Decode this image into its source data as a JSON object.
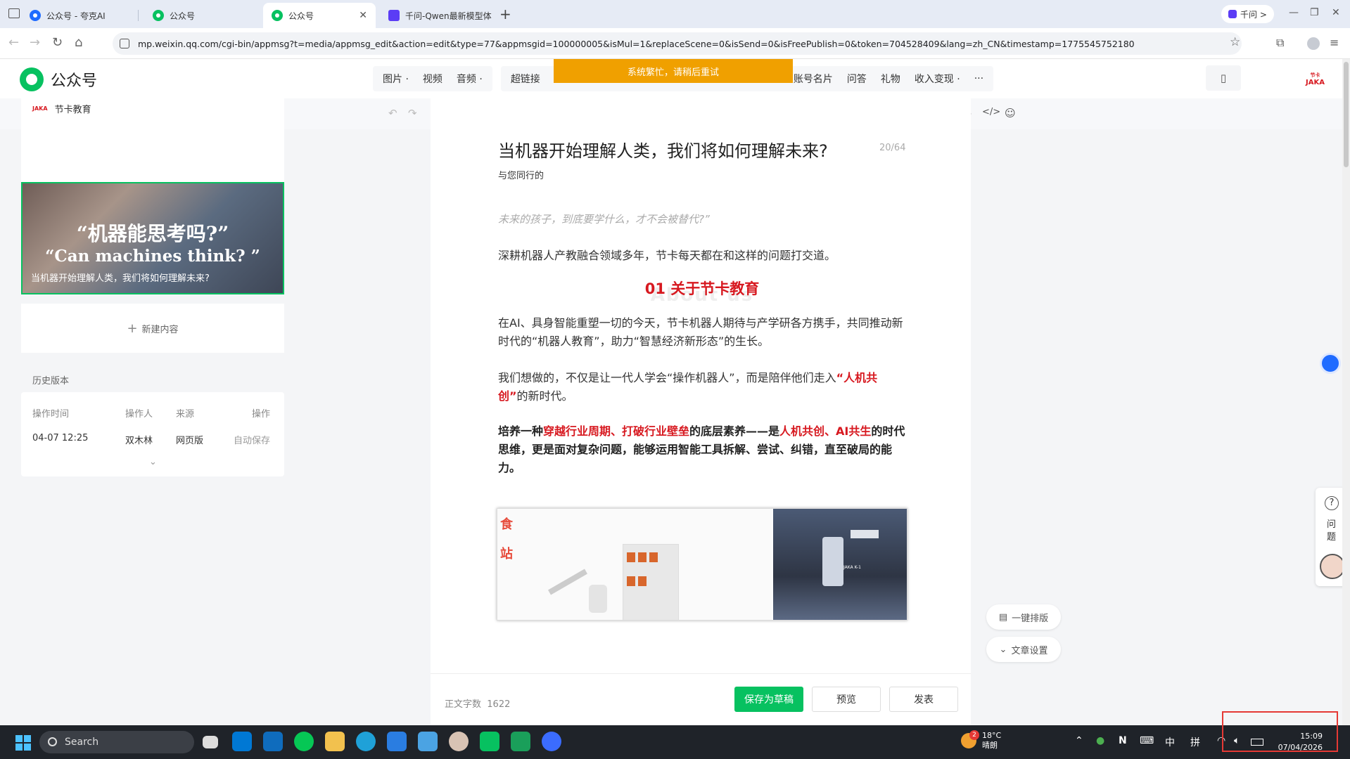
{
  "browser": {
    "tabs": [
      {
        "label": "公众号 - 夸克AI",
        "icon": "quark-icon"
      },
      {
        "label": "公众号",
        "icon": "wechat-mp-icon"
      },
      {
        "label": "公众号",
        "icon": "wechat-mp-icon"
      },
      {
        "label": "千问-Qwen最新模型体",
        "icon": "qwen-icon"
      }
    ],
    "qwen_pill": "千问 >",
    "url": "mp.weixin.qq.com/cgi-bin/appmsg?t=media/appmsg_edit&action=edit&type=77&appmsgid=100000005&isMul=1&replaceScene=0&isSend=0&isFreePublish=0&token=704528409&lang=zh_CN&timestamp=1775545752180"
  },
  "header": {
    "logo_text": "公众号",
    "menu_group1": [
      "图片 ·",
      "视频",
      "音频 ·"
    ],
    "menu_group2": [
      "超链接",
      "账号名片",
      "问答",
      "礼物",
      "收入变现 ·",
      "···"
    ],
    "toast": "系统繁忙，请稍后重试",
    "brand": "JAKA",
    "brand_cn": "节卡"
  },
  "toolbar": {
    "font_size": "16px"
  },
  "left": {
    "account_name": "节卡教育",
    "cover_line1": "“机器能思考吗?”",
    "cover_line2": "“Can machines think? ”",
    "cover_caption": "当机器开始理解人类，我们将如何理解未来?",
    "new_content": "新建内容",
    "history_title": "历史版本",
    "history_headers": [
      "操作时间",
      "操作人",
      "来源",
      "操作"
    ],
    "history_row": [
      "04-07 12:25",
      "双木林",
      "网页版",
      "自动保存"
    ]
  },
  "editor": {
    "title": "当机器开始理解人类，我们将如何理解未来?",
    "counter": "20/64",
    "author": "与您同行的",
    "quote": "未来的孩子，到底要学什么，才不会被替代?”",
    "para1": "深耕机器人产教融合领域多年，节卡每天都在和这样的问题打交道。",
    "section": "01 关于节卡教育",
    "section_bg": "About us",
    "para2": "在AI、具身智能重塑一切的今天，节卡机器人期待与产学研各方携手，共同推动新时代的“机器人教育”，助力“智慧经济新形态”的生长。",
    "para3_a": "我们想做的，不仅是让一代人学会“操作机器人”，而是陪伴他们走入",
    "para3_red": "“人机共创”",
    "para3_b": "的新时代。",
    "para4_a": "培养一种",
    "para4_red1": "穿越行业周期、打破行业壁垒",
    "para4_b": "的底层素养——是",
    "para4_red2": "人机共创、AI共生",
    "para4_c": "的时代思维，更是面对复杂问题，能够运用智能工具拆解、尝试、纠错，直至破局的能力。",
    "photo_label": "JAKA K-1"
  },
  "footer": {
    "wordcount_label": "正文字数",
    "wordcount": "1622",
    "save": "保存为草稿",
    "preview": "预览",
    "publish": "发表"
  },
  "side": {
    "format": "一键排版",
    "settings": "文章设置",
    "help": "问题"
  },
  "taskbar": {
    "search": "Search",
    "temp": "18°C",
    "weather": "晴朗",
    "weather_badge": "2",
    "ime1": "中",
    "ime2": "拼",
    "time": "15:09",
    "date": "07/04/2026"
  }
}
